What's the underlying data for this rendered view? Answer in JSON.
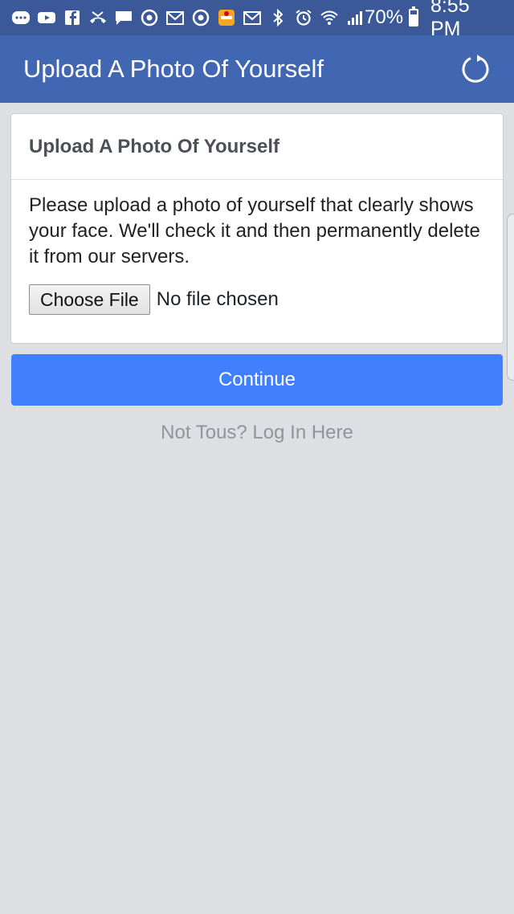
{
  "status_bar": {
    "icons": [
      "messenger-icon",
      "youtube-icon",
      "facebook-icon",
      "missed-call-icon",
      "chat-icon",
      "chrome-icon",
      "gmail-icon",
      "chrome-icon",
      "app-icon",
      "gmail-icon",
      "bluetooth-icon",
      "alarm-icon",
      "wifi-icon",
      "signal-icon"
    ],
    "battery_percent": "70%",
    "battery_level": 0.7,
    "time": "8:55 PM"
  },
  "header": {
    "title": "Upload A Photo Of Yourself",
    "refresh_icon": "refresh-icon"
  },
  "card": {
    "title": "Upload A Photo Of Yourself",
    "description": "Please upload a photo of yourself that clearly shows your face. We'll check it and then permanently delete it from our servers.",
    "choose_file_label": "Choose File",
    "file_status": "No file chosen"
  },
  "continue_label": "Continue",
  "login_link": "Not Tous? Log In Here",
  "colors": {
    "status_bar": "#3b5998",
    "header": "#4267b2",
    "background": "#dddfe2",
    "button": "#4080ff"
  }
}
